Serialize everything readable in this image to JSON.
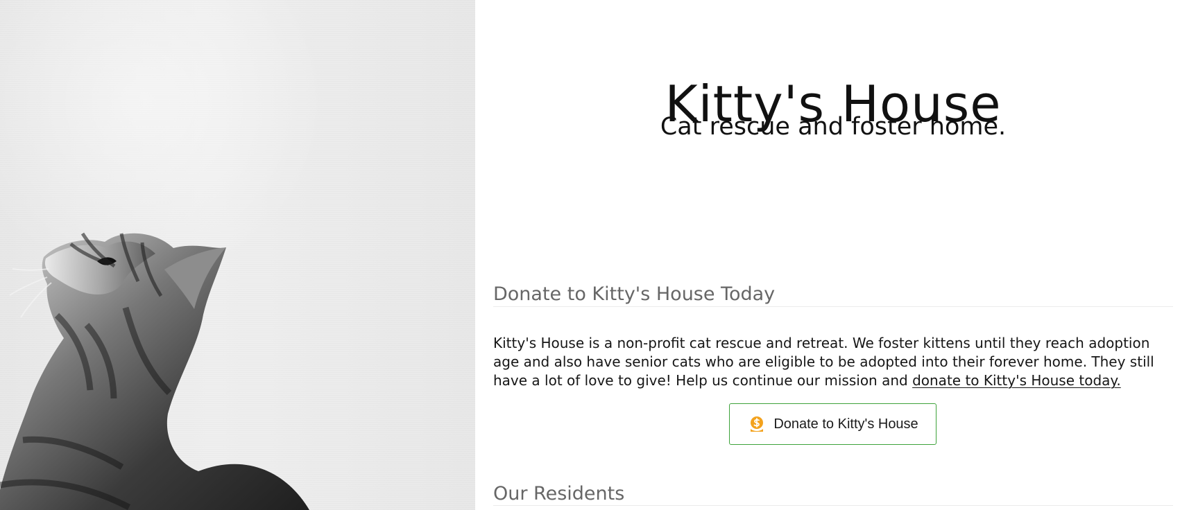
{
  "header": {
    "title": "Kitty's House",
    "subtitle": "Cat rescue and foster home."
  },
  "hero": {
    "icon": "cat-photo"
  },
  "donate": {
    "heading": "Donate to Kitty's House Today",
    "body_text": "Kitty's House is a non-profit cat rescue and retreat. We foster kittens until they reach adoption age and also have senior cats who are eligible to be adopted into their forever home. They still have a lot of love to give! Help us continue our mission and ",
    "link_text": "donate to Kitty's House today.",
    "button_label": "Donate to Kitty's House",
    "button_icon": "money-bag-icon",
    "accent_color": "#3da23a"
  },
  "residents": {
    "heading": "Our Residents"
  }
}
